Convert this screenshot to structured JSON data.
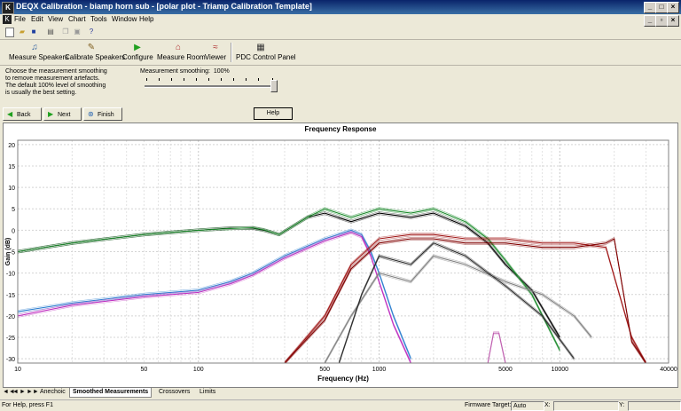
{
  "window": {
    "title": "DEQX Calibration - biamp horn sub - [polar plot - Triamp Calibration Template]",
    "app_icon": "K"
  },
  "menu": [
    "File",
    "Edit",
    "View",
    "Chart",
    "Tools",
    "Window",
    "Help"
  ],
  "toolbar_big": [
    "Measure Speakers",
    "Calibrate Speakers",
    "Configure",
    "Measure Room",
    "Viewer",
    "PDC Control Panel"
  ],
  "instructions": "Choose the measurement smoothing to remove measurement artefacts. The default 100% level of smoothing is usually the best setting.",
  "smoothing": {
    "label": "Measurement smoothing:",
    "value": "100%",
    "level": 1.0
  },
  "nav": {
    "back": "Back",
    "next": "Next",
    "finish": "Finish",
    "help": "Help"
  },
  "chart": {
    "title": "Frequency Response",
    "xlabel": "Frequency (Hz)",
    "ylabel": "Gain (dB)"
  },
  "chart_data": {
    "type": "line",
    "title": "Frequency Response",
    "xlabel": "Frequency (Hz)",
    "ylabel": "Gain (dB)",
    "xscale": "log",
    "xlim": [
      10,
      40000
    ],
    "ylim": [
      -31,
      21
    ],
    "xticks": [
      10,
      50,
      100,
      500,
      1000,
      5000,
      10000,
      40000
    ],
    "xtick_labels": [
      "10",
      "50",
      "100",
      "500",
      "1000",
      "5000",
      "10000",
      "40000"
    ],
    "yticks": [
      20,
      15,
      10,
      5,
      0,
      -5,
      -10,
      -15,
      -20,
      -25,
      -30
    ],
    "ytick_labels": [
      "20",
      "15",
      "10",
      "5",
      "0",
      "-5",
      "-10",
      "-15",
      "-20",
      "-25",
      "-30"
    ],
    "grid": true,
    "series": [
      {
        "color": "#000000",
        "x": [
          10,
          20,
          50,
          100,
          150,
          200,
          230,
          280,
          400,
          500,
          700,
          1000,
          1500,
          2000,
          3000,
          4000,
          5000,
          7000,
          10000
        ],
        "y": [
          -5,
          -3,
          -1,
          0,
          0.5,
          0.5,
          0,
          -1,
          3,
          4,
          2,
          4,
          3,
          4,
          1,
          -3,
          -8,
          -14,
          -25
        ]
      },
      {
        "color": "#1a8a2a",
        "x": [
          10,
          20,
          50,
          100,
          150,
          200,
          230,
          280,
          400,
          500,
          700,
          1000,
          1500,
          2000,
          3000,
          4000,
          5000,
          7000,
          10000
        ],
        "y": [
          -5,
          -3,
          -1,
          0,
          0.4,
          0.6,
          0.1,
          -1,
          3,
          5,
          3,
          5,
          4,
          5,
          2,
          -2,
          -7,
          -15,
          -28
        ]
      },
      {
        "color": "#3080d0",
        "x": [
          10,
          20,
          50,
          100,
          150,
          200,
          300,
          500,
          700,
          800,
          900,
          1000,
          1200,
          1500
        ],
        "y": [
          -19,
          -17,
          -15,
          -14,
          -12,
          -10,
          -6,
          -2,
          0,
          -1,
          -5,
          -10,
          -20,
          -30
        ]
      },
      {
        "color": "#c030c0",
        "x": [
          10,
          20,
          50,
          100,
          150,
          200,
          300,
          500,
          700,
          800,
          900,
          1000,
          1200,
          1500
        ],
        "y": [
          -20,
          -17.5,
          -15.5,
          -14.5,
          -12.5,
          -10.5,
          -6.5,
          -2.5,
          -0.5,
          -1.5,
          -6,
          -12,
          -22,
          -31
        ]
      },
      {
        "color": "#a01818",
        "x": [
          300,
          500,
          700,
          1000,
          1500,
          2000,
          3000,
          5000,
          8000,
          12000,
          18000,
          25000,
          30000
        ],
        "y": [
          -31,
          -20,
          -8,
          -2,
          -1,
          -1,
          -2,
          -2,
          -3,
          -3,
          -4,
          -25,
          -31
        ]
      },
      {
        "color": "#800000",
        "x": [
          300,
          500,
          700,
          1000,
          1500,
          2000,
          3000,
          5000,
          8000,
          12000,
          18000,
          20000,
          25000,
          30000
        ],
        "y": [
          -31,
          -21,
          -9,
          -3,
          -2,
          -2,
          -3,
          -3,
          -4,
          -4,
          -3,
          -2,
          -26,
          -31
        ]
      },
      {
        "color": "#808080",
        "x": [
          500,
          700,
          1000,
          1500,
          2000,
          3000,
          5000,
          8000,
          12000,
          15000
        ],
        "y": [
          -31,
          -20,
          -10,
          -12,
          -6,
          -8,
          -12,
          -15,
          -20,
          -25
        ]
      },
      {
        "color": "#2a2a2a",
        "x": [
          600,
          800,
          1000,
          1500,
          2000,
          3000,
          5000,
          8000,
          12000
        ],
        "y": [
          -31,
          -15,
          -6,
          -8,
          -3,
          -6,
          -13,
          -20,
          -30
        ]
      },
      {
        "color": "#c060b0",
        "x": [
          4000,
          4300,
          4600,
          5000
        ],
        "y": [
          -31,
          -24,
          -24,
          -31
        ]
      }
    ]
  },
  "tabs": [
    "Anechoic",
    "Smoothed Measurements",
    "Crossovers",
    "Limits"
  ],
  "active_tab": "Smoothed Measurements",
  "status": {
    "help": "For Help, press F1",
    "firmware_label": "Firmware Target:",
    "firmware_value": "Auto",
    "x_label": "X:",
    "y_label": "Y:"
  }
}
